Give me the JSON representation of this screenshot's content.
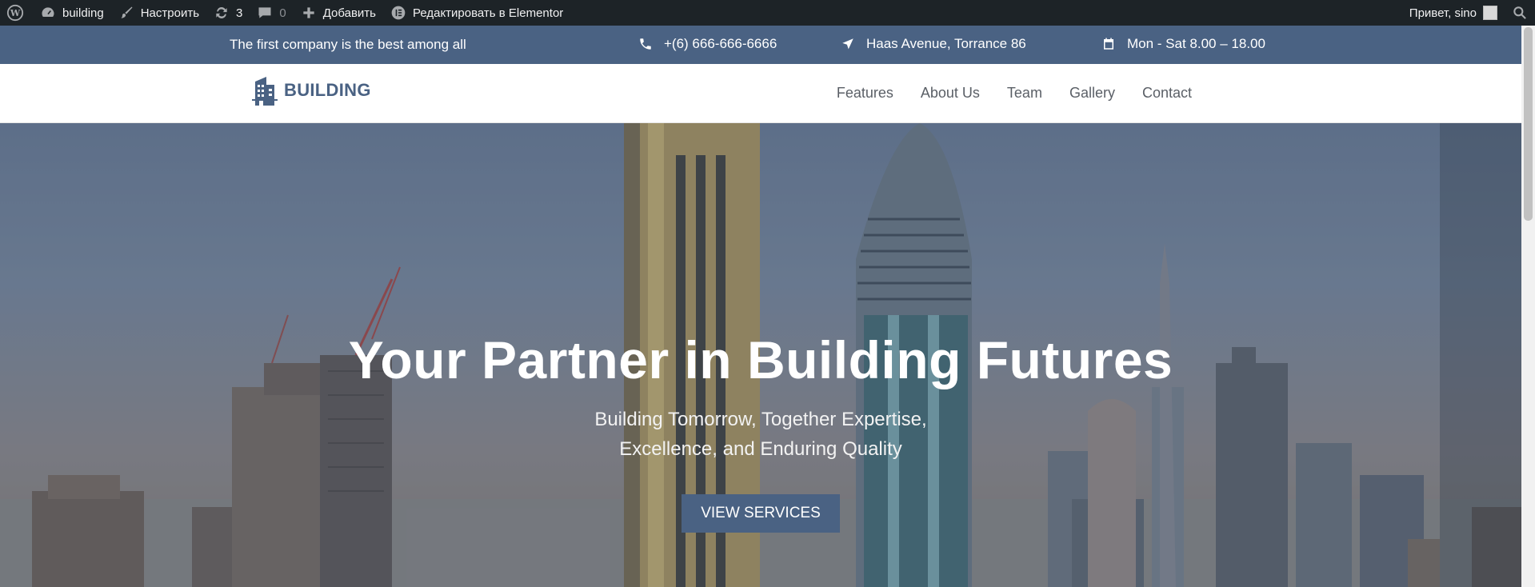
{
  "adminbar": {
    "site_name": "building",
    "customize": "Настроить",
    "updates_count": "3",
    "comments_count": "0",
    "add_new": "Добавить",
    "edit_elementor": "Редактировать в Elementor",
    "greeting": "Привет, sino"
  },
  "topbar": {
    "tagline": "The first company is the best among all",
    "phone": "+(6) 666-666-6666",
    "address": "Haas Avenue, Torrance 86",
    "hours": "Mon - Sat 8.00 – 18.00"
  },
  "header": {
    "logo_text": "BUILDING",
    "nav": [
      "Features",
      "About Us",
      "Team",
      "Gallery",
      "Contact"
    ]
  },
  "hero": {
    "title": "Your Partner in Building Futures",
    "subtitle_line1": "Building Tomorrow, Together Expertise,",
    "subtitle_line2": "Excellence, and Enduring Quality",
    "button_label": "VIEW SERVICES"
  },
  "colors": {
    "adminbar_bg": "#1d2327",
    "brand": "#4a6283",
    "header_bg": "#ffffff",
    "nav_text": "#5a5f66"
  },
  "icons": [
    "wordpress-icon",
    "dashboard-icon",
    "brush-icon",
    "updates-icon",
    "comment-icon",
    "plus-icon",
    "elementor-icon",
    "search-icon",
    "phone-icon",
    "location-arrow-icon",
    "calendar-icon",
    "building-logo-icon"
  ]
}
